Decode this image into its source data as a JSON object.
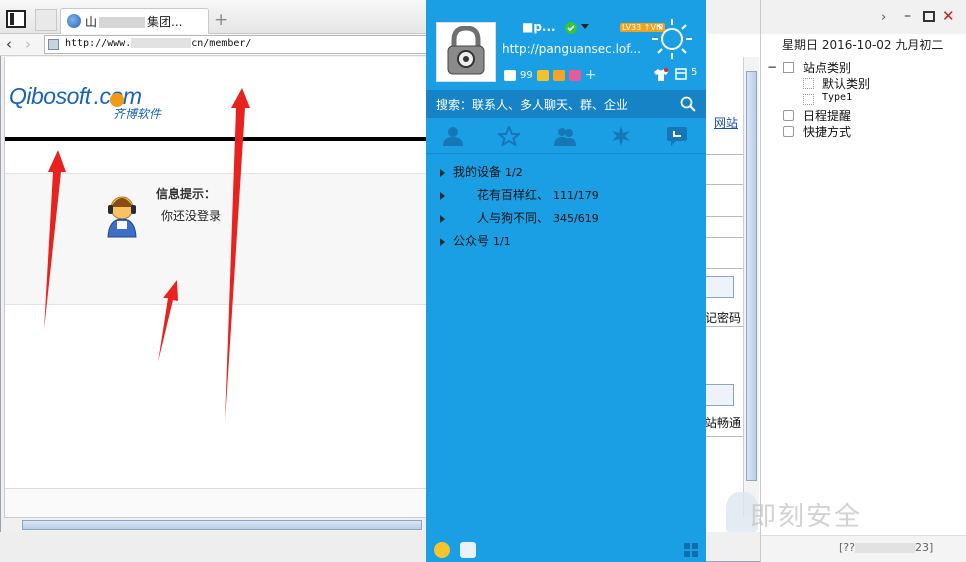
{
  "browser": {
    "tab_title_a": "山",
    "tab_title_b": "集团...",
    "new_tab": "+",
    "nav_back": "‹",
    "nav_forward": "›",
    "address_prefix": "http://www.",
    "address_suffix": "cn/member/"
  },
  "page": {
    "logo_text": "Qibosoft",
    "logo_dot_text": ".com",
    "logo_sub": "齐博软件",
    "info_title": "信息提示：",
    "info_message": "你还没登录",
    "right_link": "网站",
    "right_text1": "记密码",
    "right_text2": "站畅通"
  },
  "sidebar": {
    "date": "星期日 2016-10-02 九月初二",
    "tree": [
      {
        "label": "站点类别",
        "toggle": "−"
      },
      {
        "label": "默认类别"
      },
      {
        "label": "Type1"
      },
      {
        "label": "日程提醒"
      },
      {
        "label": "快捷方式"
      }
    ],
    "footer_a": "[??",
    "footer_b": "23]",
    "watermark": "即刻安全"
  },
  "qq": {
    "nickname": "■p...",
    "vip_badge": "LV33 ↑VIP",
    "signature": "http://panguansec.lof...",
    "mail_count": "99",
    "skin_count": "5",
    "search_placeholder": "搜索：联系人、多人聊天、群、企业",
    "groups": [
      {
        "name": "我的设备",
        "count": "1/2"
      },
      {
        "name": "花有百样红、",
        "count": "111/179"
      },
      {
        "name": "人与狗不同、",
        "count": "345/619"
      },
      {
        "name": "公众号",
        "count": "1/1"
      }
    ]
  },
  "colors": {
    "qq_blue": "#1a9fe5",
    "qq_search": "#1783c7",
    "arrow_red": "#e8231f",
    "logo_blue": "#1a63b8"
  }
}
